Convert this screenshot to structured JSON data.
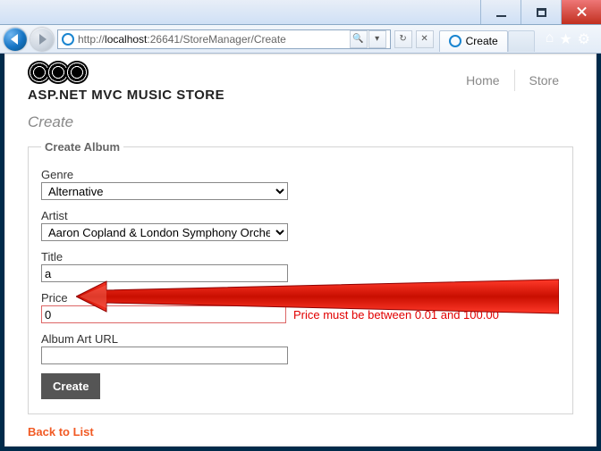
{
  "browser": {
    "url_prefix": "http://",
    "url_host": "localhost",
    "url_port": ":26641",
    "url_path": "/StoreManager/Create",
    "tab_title": "Create"
  },
  "header": {
    "site_title": "ASP.NET MVC MUSIC STORE",
    "nav": {
      "home": "Home",
      "store": "Store"
    }
  },
  "page": {
    "heading": "Create",
    "legend": "Create Album",
    "back": "Back to List"
  },
  "form": {
    "genre": {
      "label": "Genre",
      "value": "Alternative"
    },
    "artist": {
      "label": "Artist",
      "value": "Aaron Copland & London Symphony Orchestra"
    },
    "title": {
      "label": "Title",
      "value": "a"
    },
    "price": {
      "label": "Price",
      "value": "0",
      "error": "Price must be between 0.01 and 100.00"
    },
    "art": {
      "label": "Album Art URL",
      "value": ""
    },
    "submit": "Create"
  }
}
